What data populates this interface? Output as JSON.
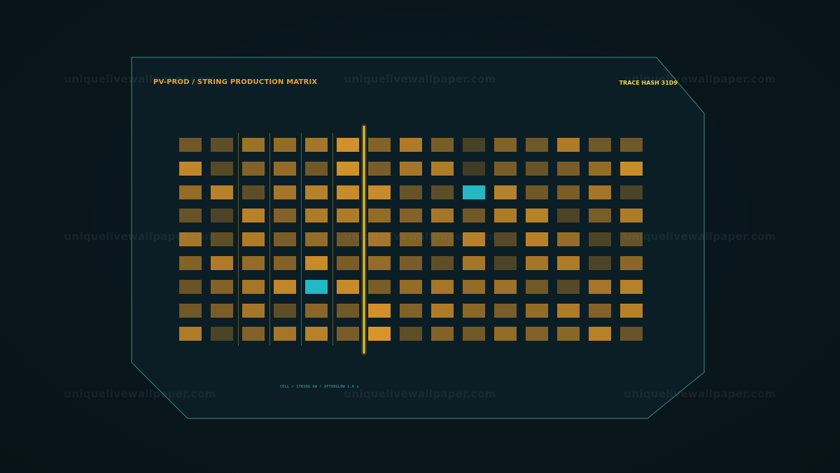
{
  "header": {
    "title": "PV-PROD / STRING PRODUCTION MATRIX",
    "trace_hash": "TRACE HASH 31D9"
  },
  "footer": {
    "legend": "CELL = STRING kW / AFTERGLOW 1.0 s"
  },
  "watermark": "uniquelivewallpaper.com",
  "colors": {
    "background": "#08161c",
    "panel_fill": "#0b1e25",
    "panel_border": "#3f8a80",
    "accent_orange": "#e39a2a",
    "accent_yellow": "#f2c62e",
    "highlight_cyan": "#22b8c4",
    "divider": "#5e5a2e"
  },
  "matrix": {
    "rows": 9,
    "cols": 15,
    "intensity": [
      [
        0.35,
        0.25,
        0.6,
        0.55,
        0.65,
        0.9,
        0.45,
        0.7,
        0.4,
        0.12,
        0.45,
        0.35,
        0.7,
        0.35,
        0.35
      ],
      [
        0.8,
        0.2,
        0.45,
        0.55,
        0.35,
        0.9,
        0.4,
        0.65,
        0.7,
        0.08,
        0.4,
        0.3,
        0.4,
        0.55,
        0.85
      ],
      [
        0.55,
        0.75,
        0.25,
        0.65,
        0.75,
        0.85,
        0.85,
        0.3,
        0.25,
        -1,
        0.75,
        0.35,
        0.4,
        0.65,
        0.15
      ],
      [
        0.3,
        0.15,
        0.75,
        0.45,
        0.7,
        0.7,
        0.55,
        0.45,
        0.65,
        0.35,
        0.7,
        0.75,
        0.15,
        0.4,
        0.7
      ],
      [
        0.65,
        0.25,
        0.7,
        0.4,
        0.55,
        0.35,
        0.65,
        0.45,
        0.45,
        0.75,
        0.2,
        0.75,
        0.55,
        0.15,
        0.3
      ],
      [
        0.45,
        0.7,
        0.55,
        0.45,
        0.85,
        0.4,
        0.55,
        0.4,
        0.25,
        0.65,
        0.15,
        0.65,
        0.7,
        0.15,
        0.5
      ],
      [
        0.3,
        0.45,
        0.65,
        0.8,
        -1,
        0.85,
        0.4,
        0.55,
        0.65,
        0.55,
        0.6,
        0.35,
        0.2,
        0.65,
        0.75
      ],
      [
        0.35,
        0.4,
        0.65,
        0.25,
        0.5,
        0.35,
        0.9,
        0.45,
        0.7,
        0.5,
        0.4,
        0.55,
        0.7,
        0.45,
        0.75
      ],
      [
        0.7,
        0.15,
        0.45,
        0.65,
        0.75,
        0.4,
        0.95,
        0.25,
        0.45,
        0.35,
        0.55,
        0.45,
        0.5,
        0.75,
        0.3
      ]
    ]
  }
}
